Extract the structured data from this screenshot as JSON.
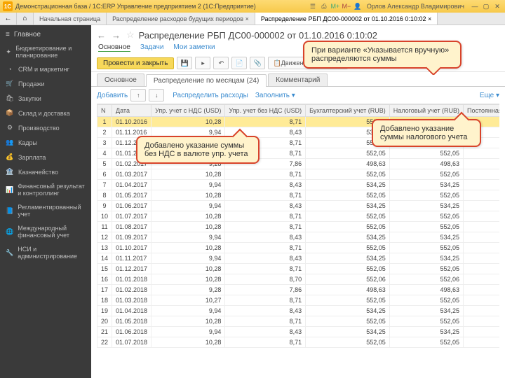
{
  "titlebar": {
    "app_logo": "1C",
    "title": "Демонстрационная база / 1С:ERP Управление предприятием 2  (1С:Предприятие)",
    "user": "Орлов Александр Владимирович"
  },
  "breadcrumbs": {
    "home": "Начальная страница",
    "t1": "Распределение расходов будущих периодов ×",
    "t2": "Распределение РБП ДС00-000002 от 01.10.2016 0:10:02 ×"
  },
  "sidebar": {
    "header": "Главное",
    "items": [
      {
        "icon": "✦",
        "label": "Бюджетирование и планирование"
      },
      {
        "icon": "◔",
        "label": "CRM и маркетинг"
      },
      {
        "icon": "🛒",
        "label": "Продажи"
      },
      {
        "icon": "🛍",
        "label": "Закупки"
      },
      {
        "icon": "📦",
        "label": "Склад и доставка"
      },
      {
        "icon": "⚙",
        "label": "Производство"
      },
      {
        "icon": "👥",
        "label": "Кадры"
      },
      {
        "icon": "💰",
        "label": "Зарплата"
      },
      {
        "icon": "🏦",
        "label": "Казначейство"
      },
      {
        "icon": "📊",
        "label": "Финансовый результат и контроллинг"
      },
      {
        "icon": "📘",
        "label": "Регламентированный учет"
      },
      {
        "icon": "🌐",
        "label": "Международный финансовый учет"
      },
      {
        "icon": "🔧",
        "label": "НСИ и администрирование"
      }
    ]
  },
  "doc": {
    "title": "Распределение РБП ДС00-000002 от 01.10.2016 0:10:02",
    "subnav": {
      "main": "Основное",
      "tasks": "Задачи",
      "notes": "Мои заметки"
    },
    "toolbar": {
      "primary": "Провести и закрыть",
      "movements": "Движения документа"
    },
    "tabs2": {
      "a": "Основное",
      "b": "Распределение по месяцам (24)",
      "c": "Комментарий"
    },
    "tbl_toolbar": {
      "add": "Добавить",
      "dist": "Распределить расходы",
      "fill": "Заполнить",
      "more": "Еще"
    },
    "columns": {
      "n": "N",
      "date": "Дата",
      "vat": "Упр. учет с НДС (USD)",
      "novat": "Упр. учет без НДС (USD)",
      "acc": "Бухгалтерский учет (RUB)",
      "tax": "Налоговый учет (RUB)",
      "perm": "Постоянная ра"
    }
  },
  "rows": [
    {
      "n": "1",
      "d": "01.10.2016",
      "v": "10,28",
      "nv": "8,71",
      "a": "552,05",
      "t": "552,05"
    },
    {
      "n": "2",
      "d": "01.11.2016",
      "v": "9,94",
      "nv": "8,43",
      "a": "534,25",
      "t": "534,25"
    },
    {
      "n": "3",
      "d": "01.12.2016",
      "v": "10,28",
      "nv": "8,71",
      "a": "552,05",
      "t": "552,05"
    },
    {
      "n": "4",
      "d": "01.01.2017",
      "v": "10,28",
      "nv": "8,71",
      "a": "552,05",
      "t": "552,05"
    },
    {
      "n": "5",
      "d": "01.02.2017",
      "v": "9,28",
      "nv": "7,86",
      "a": "498,63",
      "t": "498,63"
    },
    {
      "n": "6",
      "d": "01.03.2017",
      "v": "10,28",
      "nv": "8,71",
      "a": "552,05",
      "t": "552,05"
    },
    {
      "n": "7",
      "d": "01.04.2017",
      "v": "9,94",
      "nv": "8,43",
      "a": "534,25",
      "t": "534,25"
    },
    {
      "n": "8",
      "d": "01.05.2017",
      "v": "10,28",
      "nv": "8,71",
      "a": "552,05",
      "t": "552,05"
    },
    {
      "n": "9",
      "d": "01.06.2017",
      "v": "9,94",
      "nv": "8,43",
      "a": "534,25",
      "t": "534,25"
    },
    {
      "n": "10",
      "d": "01.07.2017",
      "v": "10,28",
      "nv": "8,71",
      "a": "552,05",
      "t": "552,05"
    },
    {
      "n": "11",
      "d": "01.08.2017",
      "v": "10,28",
      "nv": "8,71",
      "a": "552,05",
      "t": "552,05"
    },
    {
      "n": "12",
      "d": "01.09.2017",
      "v": "9,94",
      "nv": "8,43",
      "a": "534,25",
      "t": "534,25"
    },
    {
      "n": "13",
      "d": "01.10.2017",
      "v": "10,28",
      "nv": "8,71",
      "a": "552,05",
      "t": "552,05"
    },
    {
      "n": "14",
      "d": "01.11.2017",
      "v": "9,94",
      "nv": "8,43",
      "a": "534,25",
      "t": "534,25"
    },
    {
      "n": "15",
      "d": "01.12.2017",
      "v": "10,28",
      "nv": "8,71",
      "a": "552,05",
      "t": "552,05"
    },
    {
      "n": "16",
      "d": "01.01.2018",
      "v": "10,28",
      "nv": "8,70",
      "a": "552,06",
      "t": "552,06"
    },
    {
      "n": "17",
      "d": "01.02.2018",
      "v": "9,28",
      "nv": "7,86",
      "a": "498,63",
      "t": "498,63"
    },
    {
      "n": "18",
      "d": "01.03.2018",
      "v": "10,27",
      "nv": "8,71",
      "a": "552,05",
      "t": "552,05"
    },
    {
      "n": "19",
      "d": "01.04.2018",
      "v": "9,94",
      "nv": "8,43",
      "a": "534,25",
      "t": "534,25"
    },
    {
      "n": "20",
      "d": "01.05.2018",
      "v": "10,28",
      "nv": "8,71",
      "a": "552,05",
      "t": "552,05"
    },
    {
      "n": "21",
      "d": "01.06.2018",
      "v": "9,94",
      "nv": "8,43",
      "a": "534,25",
      "t": "534,25"
    },
    {
      "n": "22",
      "d": "01.07.2018",
      "v": "10,28",
      "nv": "8,71",
      "a": "552,05",
      "t": "552,05"
    }
  ],
  "callouts": {
    "c1": "При варианте «Указывается вручную» распределяются суммы",
    "c2": "Добавлено указание суммы без НДС в валюте упр. учета",
    "c3": "Добавлено указание суммы налогового учета"
  }
}
